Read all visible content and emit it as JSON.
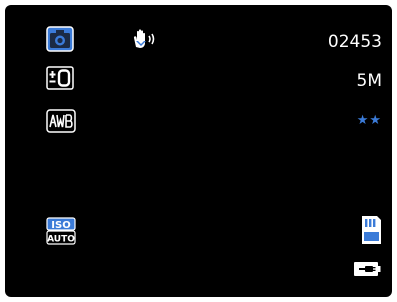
{
  "overlay": {
    "shot_counter": "02453",
    "resolution": "5M",
    "quality_stars": "★★",
    "ev_label": "±0",
    "wb_label": "AWB",
    "iso_top": "ISO",
    "iso_bottom": "AUTO"
  },
  "icons": {
    "mode": "camera-mode-icon",
    "stabilizer": "hand-shake-stabilizer-icon",
    "exposure": "exposure-compensation-icon",
    "white_balance": "auto-white-balance-icon",
    "iso": "iso-auto-icon",
    "storage": "sd-card-icon",
    "battery": "power-plug-icon"
  },
  "colors": {
    "background": "#000000",
    "text": "#ffffff",
    "accent": "#3b7bd8"
  }
}
